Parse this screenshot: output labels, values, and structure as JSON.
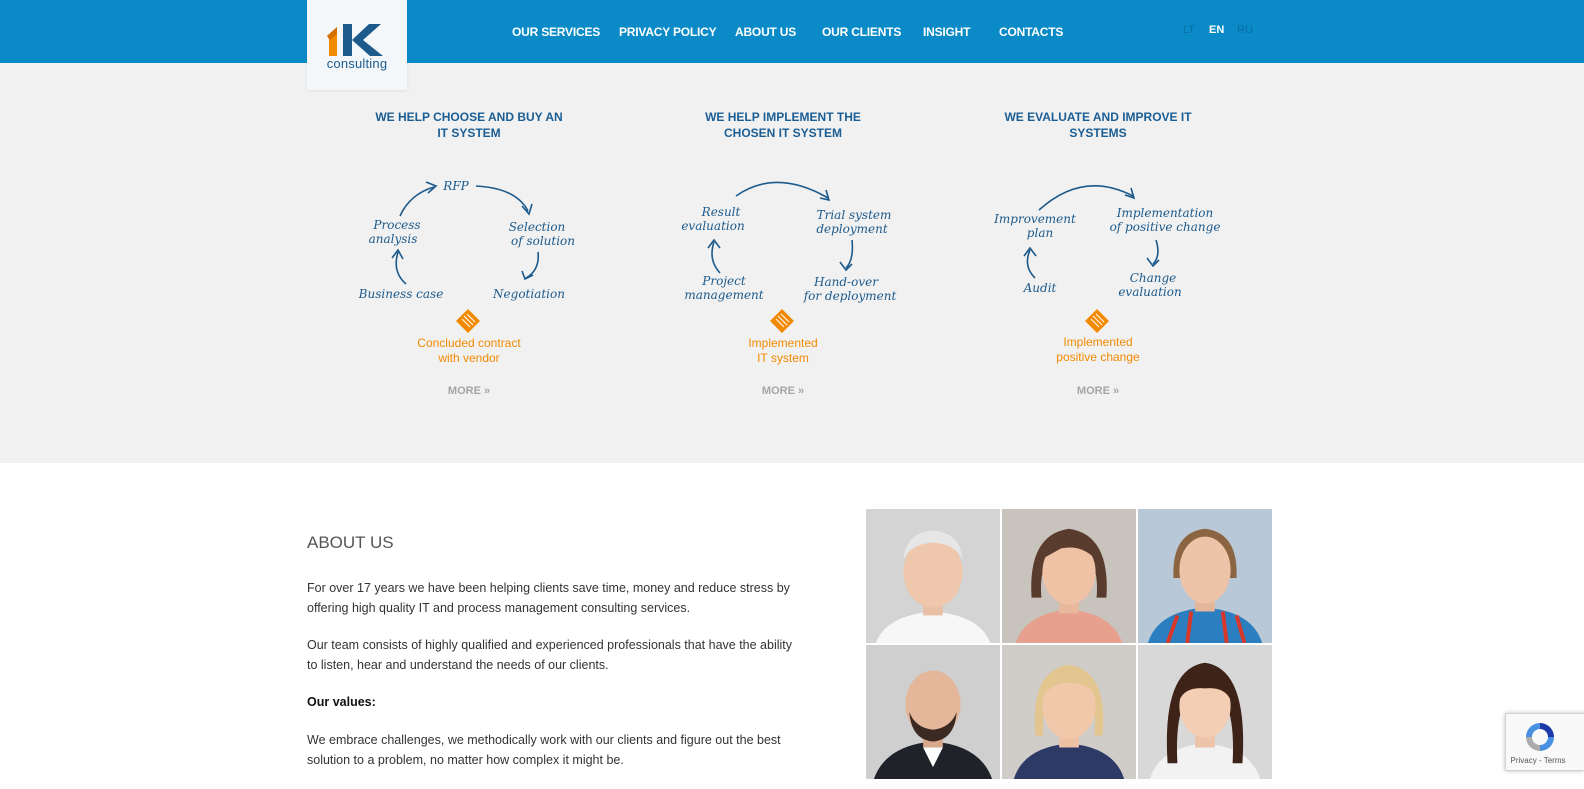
{
  "header": {
    "logo_mark": "1K",
    "logo_word": "consulting",
    "nav": [
      {
        "label": "OUR SERVICES"
      },
      {
        "label": "PRIVACY POLICY"
      },
      {
        "label": "ABOUT US"
      },
      {
        "label": "OUR CLIENTS"
      },
      {
        "label": "INSIGHT"
      },
      {
        "label": "CONTACTS"
      }
    ],
    "languages": [
      {
        "code": "LT",
        "active": false
      },
      {
        "code": "EN",
        "active": true
      },
      {
        "code": "RU",
        "active": false
      }
    ]
  },
  "services": [
    {
      "title_line1": "WE HELP CHOOSE AND BUY AN",
      "title_line2": "IT SYSTEM",
      "steps": {
        "a": "RFP",
        "b1": "Selection",
        "b2": "of solution",
        "c": "Negotiation",
        "d": "Business case",
        "e1": "Process",
        "e2": "analysis"
      },
      "result_line1": "Concluded contract",
      "result_line2": "with vendor",
      "more": "MORE »"
    },
    {
      "title_line1": "WE HELP IMPLEMENT THE",
      "title_line2": "CHOSEN IT SYSTEM",
      "steps": {
        "a1": "Result",
        "a2": "evaluation",
        "b1": "Trial system",
        "b2": "deployment",
        "c1": "Hand-over",
        "c2": "for deployment",
        "d1": "Project",
        "d2": "management"
      },
      "result_line1": "Implemented",
      "result_line2": "IT system",
      "more": "MORE »"
    },
    {
      "title_line1": "WE EVALUATE AND IMPROVE IT",
      "title_line2": "SYSTEMS",
      "steps": {
        "a1": "Improvement",
        "a2": "plan",
        "b1": "Implementation",
        "b2": "of positive change",
        "c1": "Change",
        "c2": "evaluation",
        "d": "Audit"
      },
      "result_line1": "Implemented",
      "result_line2": "positive change",
      "more": "MORE »"
    }
  ],
  "about": {
    "title": "ABOUT US",
    "p1_line1": "For over 17 years we have been helping clients save time, money and reduce stress by",
    "p1_line2": "offering high quality IT and process management consulting services.",
    "p2_line1": "Our team consists of highly qualified and experienced professionals that have the ability",
    "p2_line2": "to listen, hear and understand the needs of our clients.",
    "values_heading": "Our values:",
    "p3_line1": "We embrace challenges, we methodically work with our clients and figure out the best",
    "p3_line2": "solution to a problem, no matter how complex it might be."
  },
  "recaptcha": {
    "links": "Privacy - Terms"
  },
  "colors": {
    "header_bg": "#0a8ac7",
    "brand_blue": "#1c5a8c",
    "accent_orange": "#f28a00",
    "section_bg": "#f1f1f1"
  }
}
